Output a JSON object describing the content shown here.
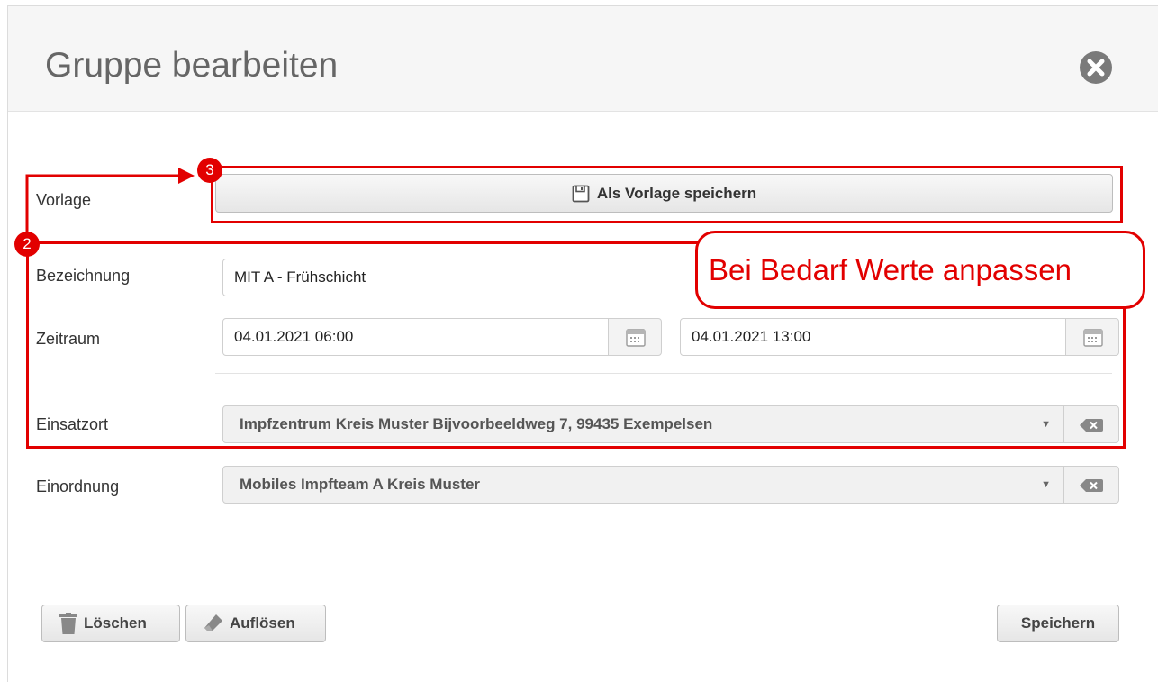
{
  "dialog": {
    "title": "Gruppe bearbeiten",
    "close_icon": "close-circle-icon"
  },
  "form": {
    "vorlage": {
      "label": "Vorlage",
      "button_label": "Als Vorlage speichern",
      "button_icon": "floppy-disk-icon"
    },
    "bezeichnung": {
      "label": "Bezeichnung",
      "value": "MIT A - Frühschicht"
    },
    "zeitraum": {
      "label": "Zeitraum",
      "start": "04.01.2021 06:00",
      "end": "04.01.2021 13:00",
      "calendar_icon": "calendar-icon"
    },
    "einsatzort": {
      "label": "Einsatzort",
      "value": "Impfzentrum Kreis Muster Bijvoorbeeldweg 7, 99435 Exempelsen"
    },
    "einordnung": {
      "label": "Einordnung",
      "value": "Mobiles Impfteam A Kreis Muster"
    }
  },
  "footer": {
    "delete_label": "Löschen",
    "dissolve_label": "Auflösen",
    "save_label": "Speichern"
  },
  "annotations": {
    "badge_step_2": "2",
    "badge_step_3": "3",
    "callout_text": "Bei Bedarf Werte anpassen",
    "color": "#e20000"
  }
}
